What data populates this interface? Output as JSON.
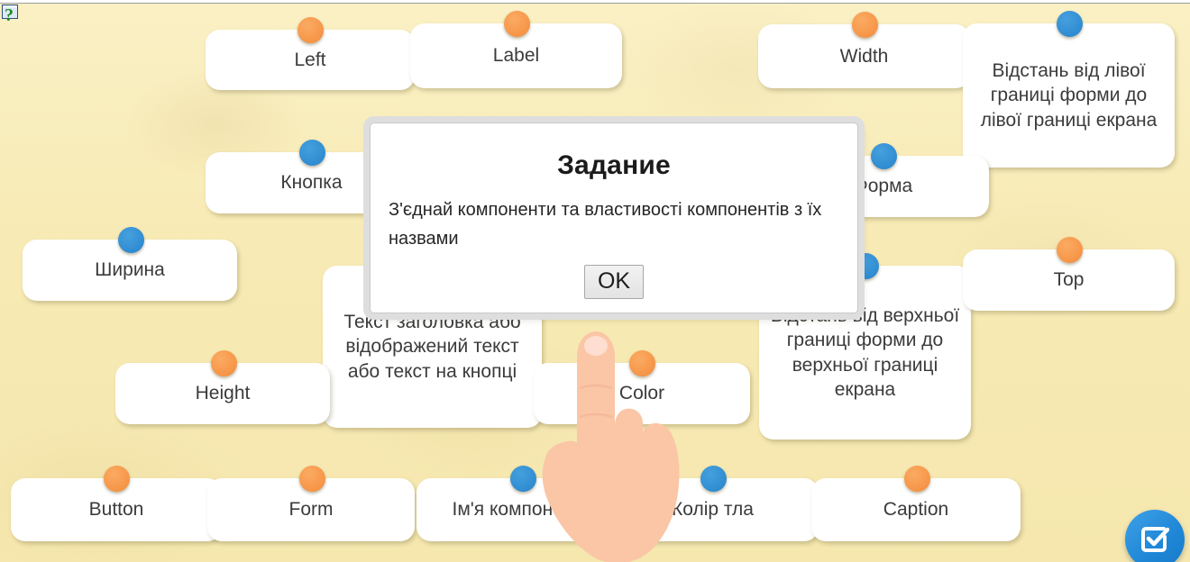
{
  "app": {
    "background_color": "#f7ebb7",
    "orange_dot_color": "#f7964a",
    "blue_dot_color": "#2e8fd4",
    "help_icon": "question-mark-icon"
  },
  "dialog": {
    "title": "Задание",
    "message": "З'єднай компоненти та властивості компонентів з їх назвами",
    "ok_label": "OK"
  },
  "fab": {
    "icon": "checkbox-check-icon",
    "color": "#1f87d6"
  },
  "cursor": {
    "icon": "pointing-hand-icon"
  },
  "cards": [
    {
      "id": "left",
      "label": "Left",
      "dot": "orange"
    },
    {
      "id": "label",
      "label": "Label",
      "dot": "orange"
    },
    {
      "id": "width",
      "label": "Width",
      "dot": "orange"
    },
    {
      "id": "distance-left",
      "label": "Відстань від лівої границі форми до лівої границі екрана",
      "dot": "blue"
    },
    {
      "id": "knopka",
      "label": "Кнопка",
      "dot": "blue"
    },
    {
      "id": "hidden-behind",
      "label": "",
      "dot": "blue"
    },
    {
      "id": "forma",
      "label": "Форма",
      "dot": "blue"
    },
    {
      "id": "shyryna",
      "label": "Ширина",
      "dot": "blue"
    },
    {
      "id": "text-caption",
      "label": "Текст заголовка або відображений текст або текст на кнопці",
      "dot": "blue"
    },
    {
      "id": "distance-top",
      "label": "Відстань від верхньої границі форми до верхньої границі екрана",
      "dot": "blue"
    },
    {
      "id": "top",
      "label": "Top",
      "dot": "orange"
    },
    {
      "id": "height",
      "label": "Height",
      "dot": "orange"
    },
    {
      "id": "color",
      "label": "Color",
      "dot": "orange"
    },
    {
      "id": "button",
      "label": "Button",
      "dot": "orange"
    },
    {
      "id": "form",
      "label": "Form",
      "dot": "orange"
    },
    {
      "id": "imya-komponenta",
      "label": "Ім'я компонента",
      "dot": "blue"
    },
    {
      "id": "kolir-tla",
      "label": "Колір тла",
      "dot": "blue"
    },
    {
      "id": "caption",
      "label": "Caption",
      "dot": "orange"
    }
  ]
}
